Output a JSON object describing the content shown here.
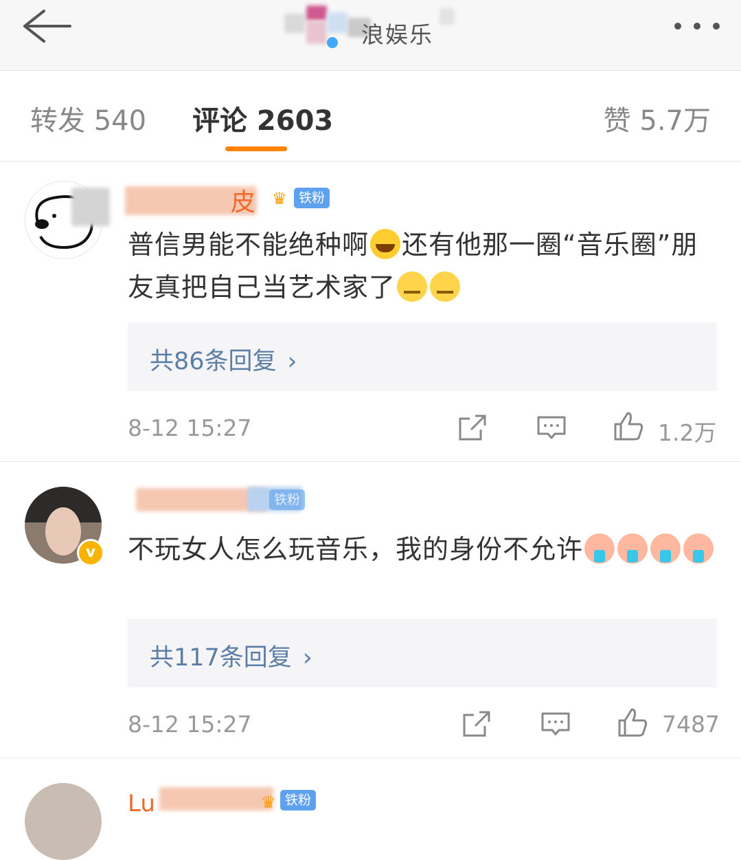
{
  "header": {
    "title_visible_part": "浪娱乐"
  },
  "tabs": [
    {
      "label": "转发 540"
    },
    {
      "label": "评论 2603"
    },
    {
      "label": "赞 5.7万"
    }
  ],
  "comments": [
    {
      "username_visible_part": "皮",
      "badge": "铁粉",
      "text_part1": "普信男能不能绝种啊",
      "text_part2": "还有他那一圈“音乐圈”朋友真把自己当艺术家了",
      "replies": "共86条回复",
      "time": "8-12 15:27",
      "likes": "1.2万"
    },
    {
      "username_visible_part": "",
      "badge": "铁粉",
      "text": "不玩女人怎么玩音乐，我的身份不允许",
      "replies": "共117条回复",
      "time": "8-12 15:27",
      "likes": "7487"
    },
    {
      "username_visible_part": "Lu",
      "badge": "铁粉"
    }
  ],
  "colors": {
    "accent": "#ff8200",
    "link": "#5b7ea6",
    "badge": "#5ea2ef",
    "verified": "#f8b400"
  }
}
